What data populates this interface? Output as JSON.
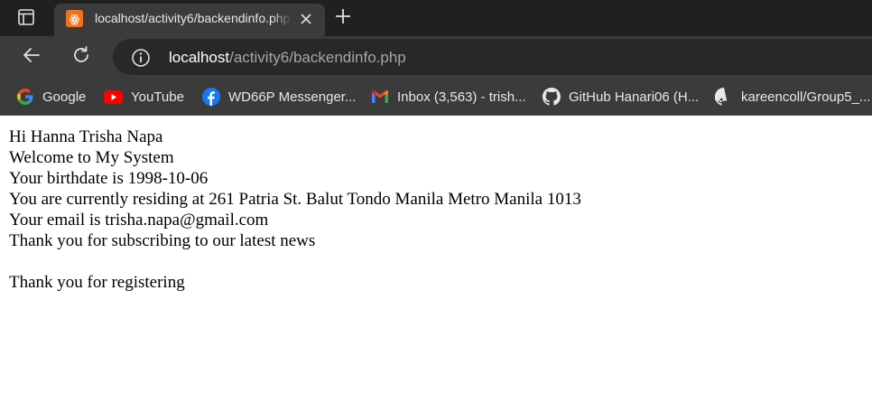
{
  "browser": {
    "tab": {
      "title": "localhost/activity6/backendinfo.php",
      "favicon": "xampp-icon"
    },
    "address_bar": {
      "host": "localhost",
      "path": "/activity6/backendinfo.php"
    },
    "bookmarks": [
      {
        "label": "Google",
        "icon": "google-icon"
      },
      {
        "label": "YouTube",
        "icon": "youtube-icon"
      },
      {
        "label": "WD66P Messenger...",
        "icon": "facebook-icon"
      },
      {
        "label": "Inbox (3,563) - trish...",
        "icon": "gmail-icon"
      },
      {
        "label": "GitHub Hanari06 (H...",
        "icon": "github-icon"
      },
      {
        "label": "kareencoll/Group5_...",
        "icon": "github-icon"
      }
    ],
    "colors": {
      "tabstrip": "#202020",
      "toolbar": "#3b3b3b",
      "omnibox": "#282828",
      "xampp_orange": "#f2711c"
    }
  },
  "page": {
    "lines": [
      "Hi Hanna Trisha Napa",
      "Welcome to My System",
      "Your birthdate is 1998-10-06",
      "You are currently residing at 261 Patria St. Balut Tondo Manila Metro Manila 1013",
      "Your email is trisha.napa@gmail.com",
      "Thank you for subscribing to our latest news",
      "",
      "Thank you for registering"
    ]
  }
}
